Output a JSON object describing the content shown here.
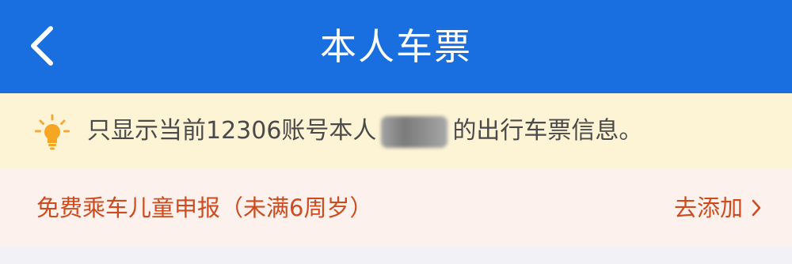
{
  "header": {
    "title": "本人车票",
    "back_icon": "chevron-left-icon",
    "background_color": "#1a6fe0"
  },
  "notice": {
    "icon": "lightbulb-icon",
    "text_before": "只显示当前12306账号本人",
    "text_after": "的出行车票信息。",
    "background_color": "#fdf3d5"
  },
  "child_declaration": {
    "label": "免费乘车儿童申报（未满6周岁）",
    "action_label": "去添加",
    "action_icon": "chevron-right-icon",
    "text_color": "#cf4b1e",
    "background_color": "#fcf1ec"
  }
}
